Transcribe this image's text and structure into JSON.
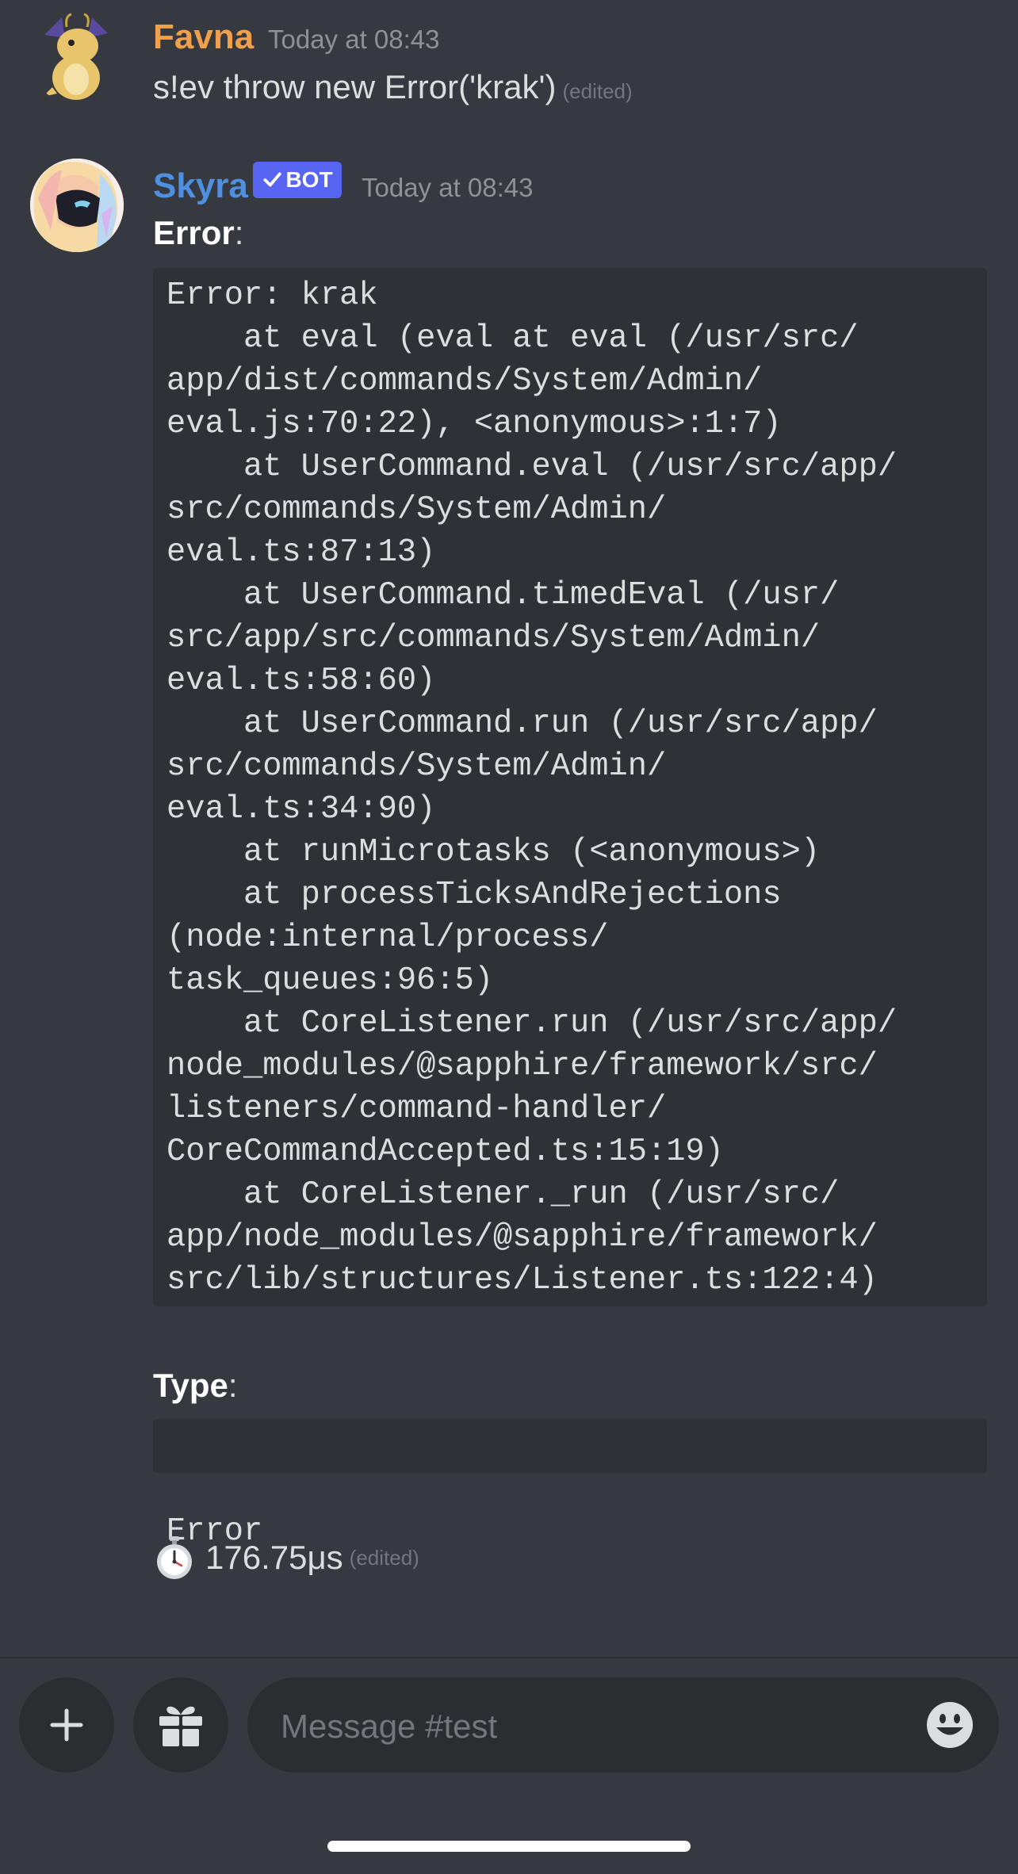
{
  "messages": [
    {
      "author": "Favna",
      "author_color": "#f0a04b",
      "timestamp": "Today at 08:43",
      "text": "s!ev throw new Error('krak')",
      "edited": "(edited)"
    },
    {
      "author": "Skyra",
      "author_color": "#4f8fe0",
      "bot_tag": "BOT",
      "timestamp": "Today at 08:43",
      "error_label": "Error",
      "error_lines": [
        "Error: krak",
        "    at eval (eval at eval (/usr/src/",
        "app/dist/commands/System/Admin/",
        "eval.js:70:22), <anonymous>:1:7)",
        "    at UserCommand.eval (/usr/src/app/",
        "src/commands/System/Admin/",
        "eval.ts:87:13)",
        "    at UserCommand.timedEval (/usr/",
        "src/app/src/commands/System/Admin/",
        "eval.ts:58:60)",
        "    at UserCommand.run (/usr/src/app/",
        "src/commands/System/Admin/",
        "eval.ts:34:90)",
        "    at runMicrotasks (<anonymous>)",
        "    at processTicksAndRejections",
        "(node:internal/process/",
        "task_queues:96:5)",
        "    at CoreListener.run (/usr/src/app/",
        "node_modules/@sapphire/framework/src/",
        "listeners/command-handler/",
        "CoreCommandAccepted.ts:15:19)",
        "    at CoreListener._run (/usr/src/",
        "app/node_modules/@sapphire/framework/",
        "src/lib/structures/Listener.ts:122:4)"
      ],
      "type_label": "Type",
      "colon": ":",
      "type_value": "Error",
      "timer_icon": "stopwatch-icon",
      "timer_value": "176.75μs",
      "edited": "(edited)"
    }
  ],
  "composer": {
    "add_icon": "plus-icon",
    "gift_icon": "gift-icon",
    "placeholder": "Message #test",
    "emoji_icon": "smiley-icon"
  },
  "colors": {
    "background": "#36393f",
    "codeblock": "#2f3136",
    "bot_tag": "#5865f2",
    "muted": "#8e9297"
  }
}
